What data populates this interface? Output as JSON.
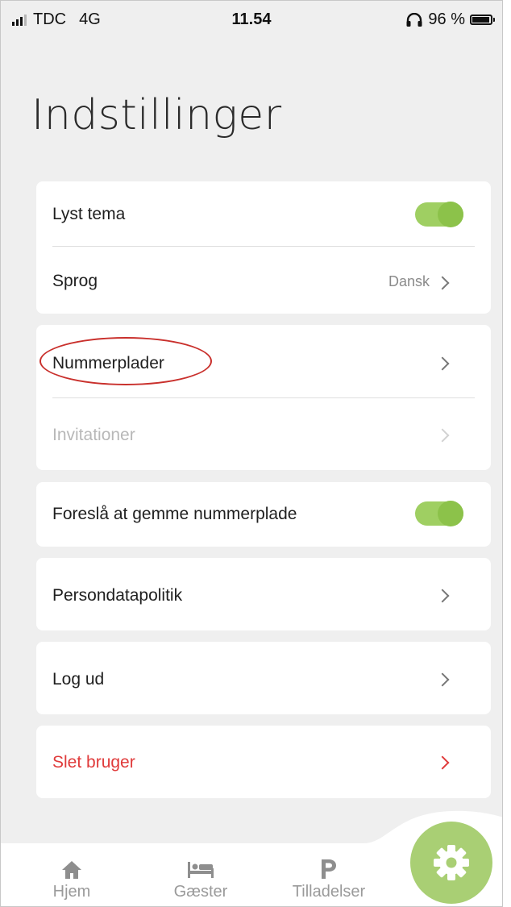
{
  "status_bar": {
    "carrier": "TDC",
    "network": "4G",
    "time": "11.54",
    "battery_text": "96 %",
    "battery_level": 0.96
  },
  "page": {
    "title": "Indstillinger"
  },
  "settings": {
    "light_theme": {
      "label": "Lyst tema",
      "enabled": true
    },
    "language": {
      "label": "Sprog",
      "value": "Dansk"
    },
    "license_plates": {
      "label": "Nummerplader"
    },
    "invitations": {
      "label": "Invitationer",
      "disabled": true
    },
    "suggest_save_plate": {
      "label": "Foreslå at gemme nummerplade",
      "enabled": true
    },
    "privacy_policy": {
      "label": "Persondatapolitik"
    },
    "log_out": {
      "label": "Log ud"
    },
    "delete_user": {
      "label": "Slet bruger"
    }
  },
  "tab_bar": {
    "tabs": [
      {
        "label": "Hjem",
        "icon": "home-icon"
      },
      {
        "label": "Gæster",
        "icon": "bed-icon"
      },
      {
        "label": "Tilladelser",
        "icon": "parking-icon"
      }
    ],
    "active_tab_icon": "gear-icon"
  },
  "colors": {
    "toggle_on": "#8cc24a",
    "danger": "#e03b3b",
    "fab": "#a9cf74",
    "highlight_annotation": "#c9302c"
  }
}
